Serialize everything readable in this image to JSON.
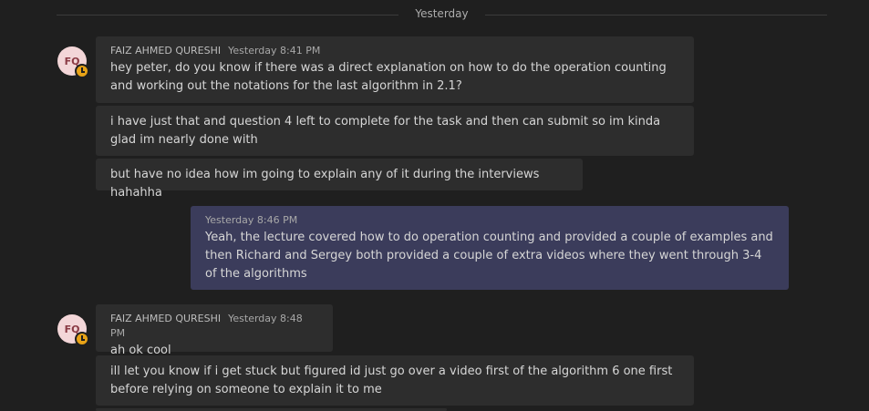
{
  "divider": {
    "label": "Yesterday"
  },
  "avatar_initials": "FQ",
  "group1": {
    "sender": "FAIZ AHMED QURESHI",
    "time": "Yesterday 8:41 PM",
    "messages": [
      "hey peter, do you know if there was a direct explanation on how to do the operation counting and working out the notations for the last algorithm in 2.1?",
      "i have just that and question 4 left to complete for the task and then can submit so im kinda glad im nearly done with",
      "but have no idea how im going to explain any of it during the interviews hahahha"
    ]
  },
  "reply": {
    "time": "Yesterday 8:46 PM",
    "message": "Yeah, the lecture covered how to do operation counting and provided a couple of examples and then Richard and Sergey both provided a couple of extra videos where they went through 3-4 of the algorithms"
  },
  "group2": {
    "sender": "FAIZ AHMED QURESHI",
    "time": "Yesterday 8:48 PM",
    "messages": [
      "ah ok cool",
      "ill let you know if i get stuck but figured id just go over a video first of the algorithm 6 one first before relying on someone to explain it to me"
    ]
  },
  "icons": {
    "status": "away-clock-icon"
  }
}
